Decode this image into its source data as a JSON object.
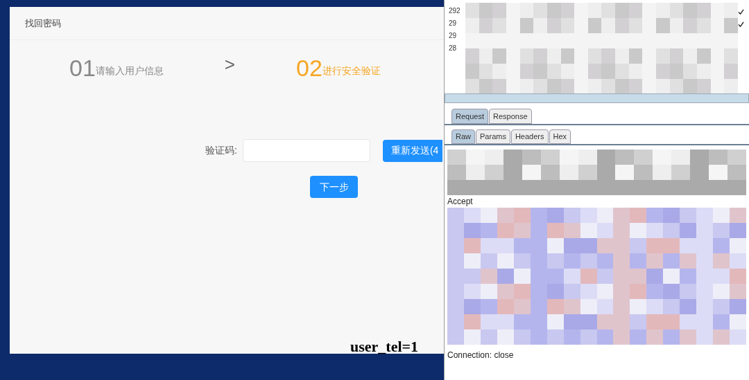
{
  "page": {
    "title": "找回密码",
    "steps": [
      {
        "number": "01",
        "label": "请输入用户信息",
        "selected": false
      },
      {
        "number": "02",
        "label": "进行安全验证",
        "selected": true
      }
    ],
    "step_separator": ">",
    "code_field": {
      "label": "验证码:"
    },
    "resend_button": "重新发送(4",
    "next_button": "下一步"
  },
  "proxy": {
    "history_rows": [
      {
        "number": "292",
        "checked": true
      },
      {
        "number": "29",
        "checked": true
      },
      {
        "number": "29",
        "checked": false
      },
      {
        "number": "28",
        "checked": false
      }
    ],
    "message_tabs": [
      {
        "label": "Request",
        "selected": true
      },
      {
        "label": "Response",
        "selected": false
      }
    ],
    "view_tabs": [
      {
        "label": "Raw",
        "selected": true
      },
      {
        "label": "Params",
        "selected": false
      },
      {
        "label": "Headers",
        "selected": false
      },
      {
        "label": "Hex",
        "selected": false
      }
    ],
    "request_lines": [
      "Accept",
      "Connection: close"
    ]
  },
  "overlay_text": "user_tel=1"
}
